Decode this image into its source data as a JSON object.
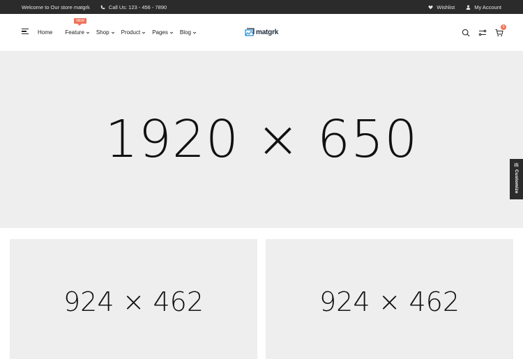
{
  "topbar": {
    "welcome": "Welcome to Our store matgrk",
    "phone": "Call Us: 123 - 456 - 7890",
    "wishlist": "Wishlist",
    "account": "My Account"
  },
  "nav": {
    "items": [
      {
        "label": "Home"
      },
      {
        "label": "Feature",
        "badge": "NEW"
      },
      {
        "label": "Shop"
      },
      {
        "label": "Product"
      },
      {
        "label": "Pages"
      },
      {
        "label": "Blog"
      }
    ]
  },
  "logo": {
    "text": "matgrk"
  },
  "header_icons": [
    "search-icon",
    "compare-icon",
    "cart-icon"
  ],
  "cart": {
    "count": "0"
  },
  "hero": {
    "placeholder": "1920 × 650"
  },
  "customize": {
    "label": "Customize"
  },
  "banners": [
    {
      "placeholder": "924 × 462"
    },
    {
      "placeholder": "924 × 462"
    }
  ],
  "colors": {
    "topbar_bg": "#2b2b2b",
    "accent": "#f0735a",
    "placeholder_bg": "#eeeeee"
  }
}
